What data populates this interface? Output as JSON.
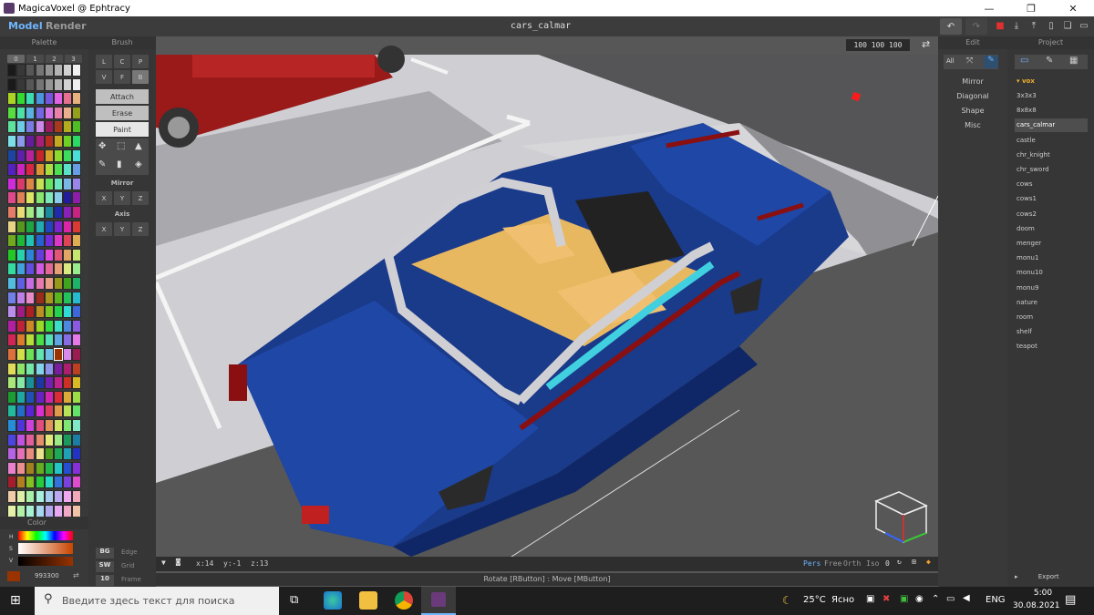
{
  "window": {
    "title": "MagicaVoxel @ Ephtracy"
  },
  "menu": {
    "model": "Model",
    "render": "Render",
    "document": "cars_calmar",
    "undo": "↶",
    "redo": "↷"
  },
  "viewport": {
    "size": "100 100 100"
  },
  "palette": {
    "title": "Palette",
    "pages": [
      "0",
      "1",
      "2",
      "3"
    ],
    "color_title": "Color",
    "hsv": [
      "H",
      "S",
      "V"
    ],
    "hex": "993300"
  },
  "brush": {
    "title": "Brush",
    "types": [
      "L",
      "C",
      "P",
      "V",
      "F",
      "B"
    ],
    "modes": [
      "Attach",
      "Erase",
      "Paint"
    ],
    "mirror_title": "Mirror",
    "mirror": [
      "X",
      "Y",
      "Z"
    ],
    "axis_title": "Axis",
    "axis": [
      "X",
      "Y",
      "Z"
    ],
    "bg": "BG",
    "bg_label": "Edge",
    "sw": "SW",
    "sw_label": "Grid",
    "frame_num": "10",
    "frame_label": "Frame"
  },
  "edit": {
    "title": "Edit",
    "all": "All",
    "items": [
      "Mirror",
      "Diagonal",
      "Shape",
      "Misc"
    ]
  },
  "project": {
    "title": "Project",
    "folder": "▾ vox",
    "files": [
      "3x3x3",
      "8x8x8",
      "cars_calmar",
      "castle",
      "chr_knight",
      "chr_sword",
      "cows",
      "cows1",
      "cows2",
      "doom",
      "menger",
      "monu1",
      "monu10",
      "monu9",
      "nature",
      "room",
      "shelf",
      "teapot"
    ],
    "export": "Export"
  },
  "status": {
    "x": "x:14",
    "y": "y:-1",
    "z": "z:13",
    "modes": [
      "Pers",
      "Free",
      "Orth",
      "Iso"
    ],
    "num": "0"
  },
  "hint": "Rotate [RButton] : Move [MButton]",
  "taskbar": {
    "search": "Введите здесь текст для поиска",
    "temp": "25°C",
    "weather": "Ясно",
    "lang": "ENG",
    "time": "5:00",
    "date": "30.08.2021"
  },
  "colors": {
    "accent": "#6fb6ff",
    "selected_color": "#993300",
    "car_blue": "#1a3a8a",
    "car_red": "#8a0f10",
    "seat": "#f0c070",
    "glass": "#40d0e0",
    "ground": "#888888"
  }
}
